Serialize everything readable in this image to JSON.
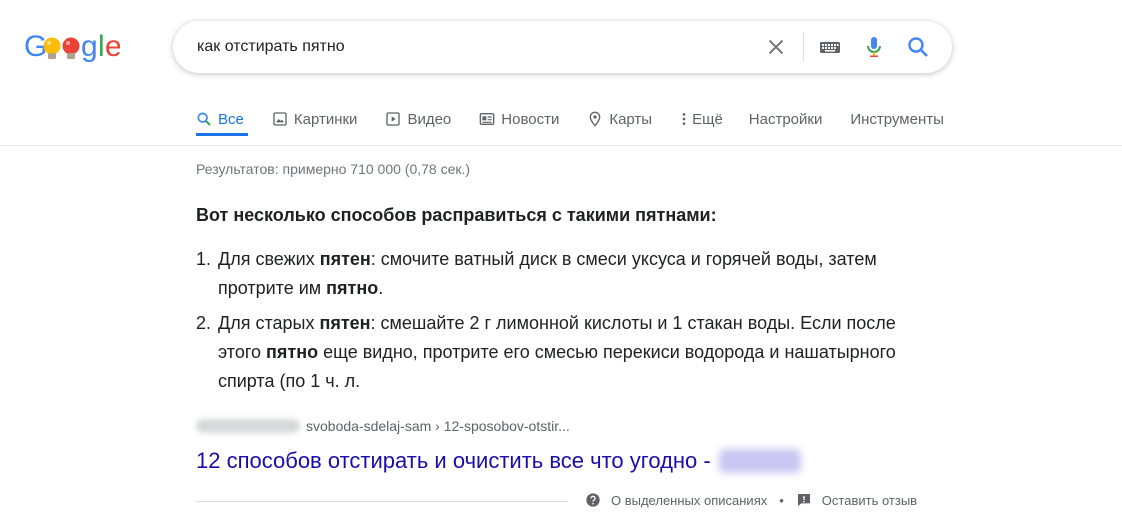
{
  "search": {
    "query": "как отстирать пятно"
  },
  "tabs": [
    {
      "label": "Все",
      "icon": "search-icon"
    },
    {
      "label": "Картинки",
      "icon": "image-icon"
    },
    {
      "label": "Видео",
      "icon": "play-icon"
    },
    {
      "label": "Новости",
      "icon": "newspaper-icon"
    },
    {
      "label": "Карты",
      "icon": "pin-icon"
    },
    {
      "label": "Ещё",
      "icon": "more-vert-icon"
    },
    {
      "label": "Настройки"
    },
    {
      "label": "Инструменты"
    }
  ],
  "results": {
    "stats": "Результатов: примерно 710 000 (0,78 сек.)",
    "snippet": {
      "title": "Вот несколько способов расправиться с такими пятнами:",
      "items": [
        {
          "num": "1.",
          "t1": "Для свежих ",
          "b1": "пятен",
          "t2": ": смочите ватный диск в смеси уксуса и горячей воды, затем протрите им ",
          "b2": "пятно",
          "t3": "."
        },
        {
          "num": "2.",
          "t1": "Для старых ",
          "b1": "пятен",
          "t2": ": смешайте 2 г лимонной кислоты и 1 стакан воды. Если после этого ",
          "b2": "пятно",
          "t3": " еще видно, протрите его смесью перекиси водорода и нашатырного спирта (по 1 ч. л."
        }
      ]
    },
    "cite_path": "svoboda-sdelaj-sam › 12-sposobov-otstir...",
    "result_title": "12 способов отстирать и очистить все что угодно -"
  },
  "footer": {
    "about_label": "О выделенных описаниях",
    "separator": "•",
    "feedback_label": "Оставить отзыв"
  },
  "colors": {
    "link": "#1a0dab",
    "active_tab": "#1a73e8",
    "muted": "#70757a"
  }
}
